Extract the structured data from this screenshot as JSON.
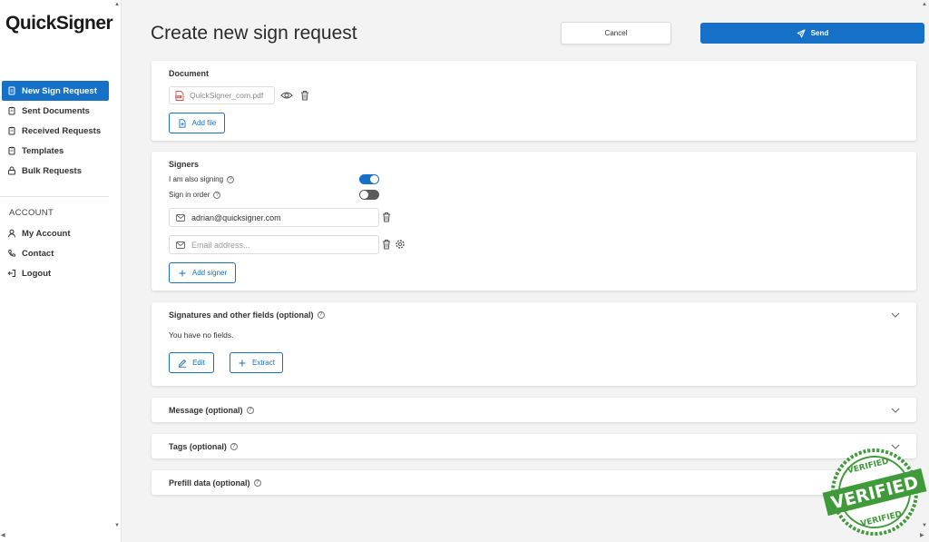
{
  "app": {
    "logo": "QuickSigner"
  },
  "sidebar": {
    "items": [
      {
        "label": "New Sign Request",
        "icon": "document-icon",
        "active": true
      },
      {
        "label": "Sent Documents",
        "icon": "clipboard-icon",
        "active": false
      },
      {
        "label": "Received Requests",
        "icon": "clipboard-icon",
        "active": false
      },
      {
        "label": "Templates",
        "icon": "clipboard-icon",
        "active": false
      },
      {
        "label": "Bulk Requests",
        "icon": "lock-icon",
        "active": false
      }
    ],
    "account_label": "ACCOUNT",
    "account_items": [
      {
        "label": "My Account",
        "icon": "user-icon"
      },
      {
        "label": "Contact",
        "icon": "phone-icon"
      },
      {
        "label": "Logout",
        "icon": "logout-icon"
      }
    ]
  },
  "header": {
    "title": "Create new sign request",
    "cancel_label": "Cancel",
    "send_label": "Send"
  },
  "document": {
    "title": "Document",
    "file_name": "QuickSigner_com.pdf",
    "add_file_label": "Add file"
  },
  "signers": {
    "title": "Signers",
    "also_signing_label": "I am also signing",
    "also_signing": true,
    "sign_in_order_label": "Sign in order",
    "sign_in_order": false,
    "emails": [
      {
        "value": "adrian@quicksigner.com",
        "placeholder": ""
      },
      {
        "value": "",
        "placeholder": "Email address..."
      }
    ],
    "add_signer_label": "Add signer"
  },
  "fields": {
    "title": "Signatures and other fields (optional)",
    "empty_text": "You have no fields.",
    "edit_label": "Edit",
    "extract_label": "Extract"
  },
  "message": {
    "title": "Message (optional)"
  },
  "tags": {
    "title": "Tags (optional)"
  },
  "prefill": {
    "title": "Prefill data (optional)"
  },
  "stamp": {
    "top": "VERIFIED",
    "main": "VERIFIED",
    "bottom": "VERIFIED"
  },
  "colors": {
    "accent": "#1570c7",
    "stamp": "#3f9b3a"
  }
}
